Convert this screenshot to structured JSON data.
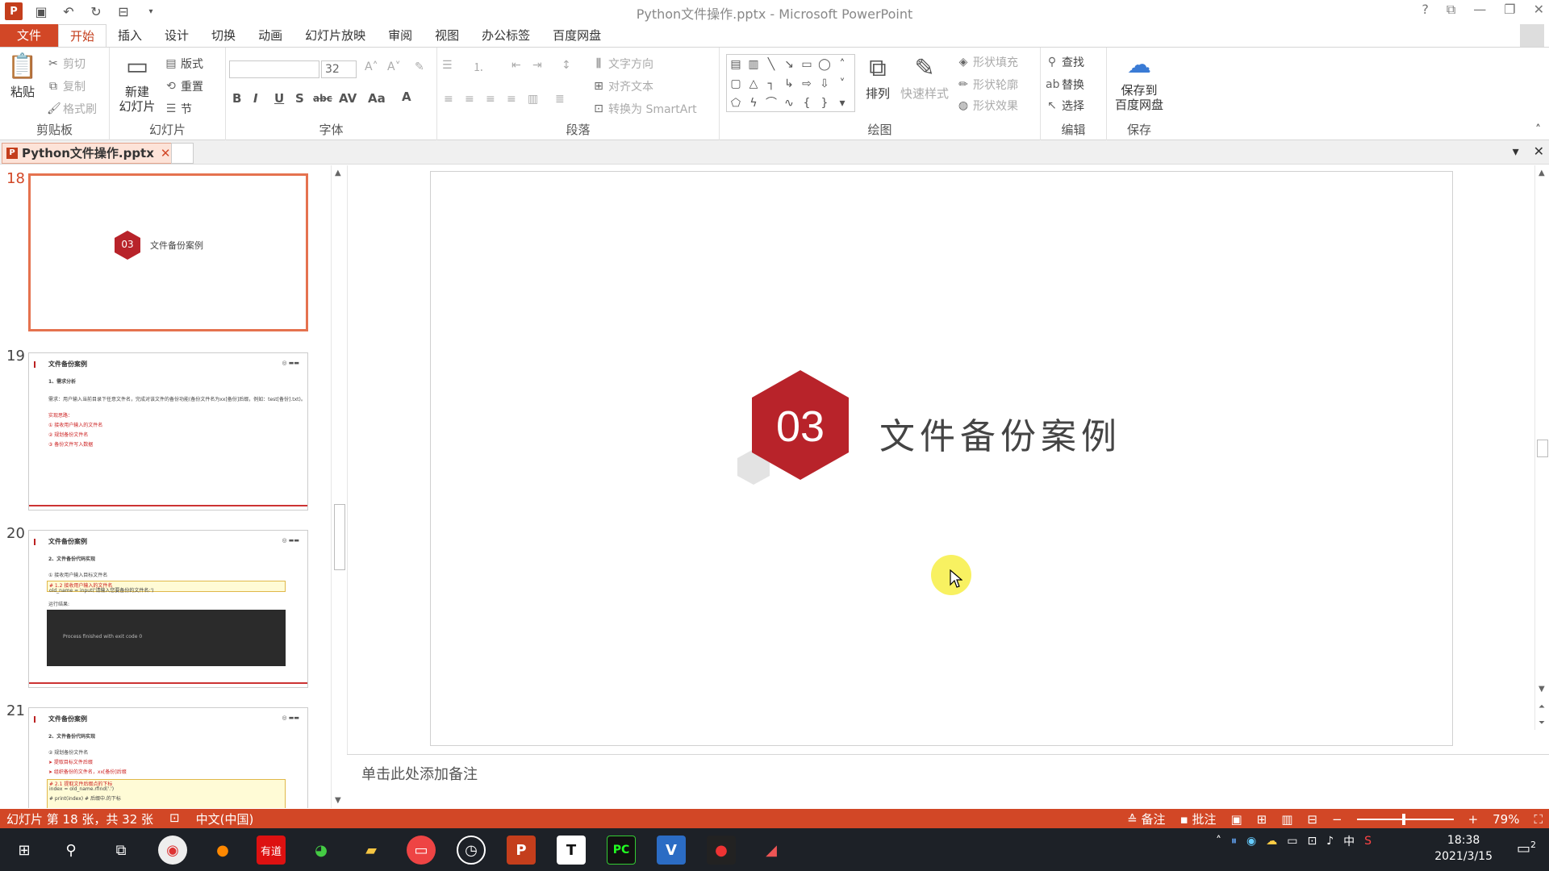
{
  "window": {
    "title": "Python文件操作.pptx - Microsoft PowerPoint",
    "qat": [
      "save-icon",
      "undo-icon",
      "redo-icon",
      "present-icon"
    ]
  },
  "tabs": [
    "文件",
    "开始",
    "插入",
    "设计",
    "切换",
    "动画",
    "幻灯片放映",
    "审阅",
    "视图",
    "办公标签",
    "百度网盘"
  ],
  "active_tab": "开始",
  "ribbon": {
    "clipboard": {
      "label": "剪贴板",
      "paste": "粘贴",
      "cut": "剪切",
      "copy": "复制",
      "format_painter": "格式刷"
    },
    "slides": {
      "label": "幻灯片",
      "new_slide_1": "新建",
      "new_slide_2": "幻灯片",
      "layout": "版式",
      "reset": "重置",
      "section": "节"
    },
    "font": {
      "label": "字体",
      "font_name": "",
      "font_size": "32"
    },
    "paragraph": {
      "label": "段落",
      "text_direction": "文字方向",
      "align_text": "对齐文本",
      "smartart": "转换为 SmartArt"
    },
    "drawing": {
      "label": "绘图",
      "arrange": "排列",
      "quick_styles": "快速样式",
      "shape_fill": "形状填充",
      "shape_outline": "形状轮廓",
      "shape_effects": "形状效果"
    },
    "editing": {
      "label": "编辑",
      "find": "查找",
      "replace": "替换",
      "select": "选择"
    },
    "save": {
      "label": "保存",
      "btn_1": "保存到",
      "btn_2": "百度网盘"
    }
  },
  "doc_tab": "Python文件操作.pptx",
  "thumbnails": [
    {
      "num": "18",
      "title": "文件备份案例",
      "badge": "03"
    },
    {
      "num": "19",
      "title": "文件备份案例",
      "sub": "1、需求分析",
      "lines": [
        "需求：用户输入当前目录下任意文件名，完成对该文件的备份功能(备份文件名为xx[备份]后缀，例如：test[备份].txt)。",
        "实现思路：",
        "① 接收用户输入的文件名",
        "② 规划备份文件名",
        "③ 备份文件写入数据"
      ]
    },
    {
      "num": "20",
      "title": "文件备份案例",
      "sub": "2、文件备份代码实现",
      "lines": [
        "① 接收用户输入目标文件名",
        "# 1.2 接收用户输入的文件名",
        "old_name = input('请输入您要备份的文件名:')",
        "运行结果:",
        "Process finished with exit code 0"
      ]
    },
    {
      "num": "21",
      "title": "文件备份案例",
      "sub": "2、文件备份代码实现",
      "lines": [
        "② 规划备份文件名",
        "➤ 提取目标文件后缀",
        "➤ 组织备份的文件名，xx[备份]后缀",
        "# 2.1 提取文件后缀点的下标",
        "index = old_name.rfind('.')",
        "# print(index) # 后缀中.的下标"
      ]
    }
  ],
  "slide": {
    "badge": "03",
    "title": "文件备份案例"
  },
  "notes_placeholder": "单击此处添加备注",
  "status": {
    "slide_info": "幻灯片 第 18 张，共 32 张",
    "language": "中文(中国)",
    "notes": "备注",
    "comments": "批注",
    "zoom": "79%"
  },
  "taskbar": {
    "apps": [
      "windows-icon",
      "search-icon",
      "task-view-icon",
      "chrome-icon",
      "firefox-icon",
      "youdao-icon",
      "browser-icon",
      "file-explorer-icon",
      "screen-recorder-icon",
      "clock-app-icon",
      "powerpoint-icon",
      "typora-icon",
      "pycharm-icon",
      "visio-icon",
      "camera-icon",
      "ruler-app-icon"
    ],
    "youdao": "有道",
    "ime": "中",
    "time": "18:38",
    "date": "2021/3/15",
    "notif_count": "2"
  },
  "colors": {
    "accent": "#d24726",
    "badge": "#b8232a",
    "hex_grey": "#e0e0e0"
  }
}
